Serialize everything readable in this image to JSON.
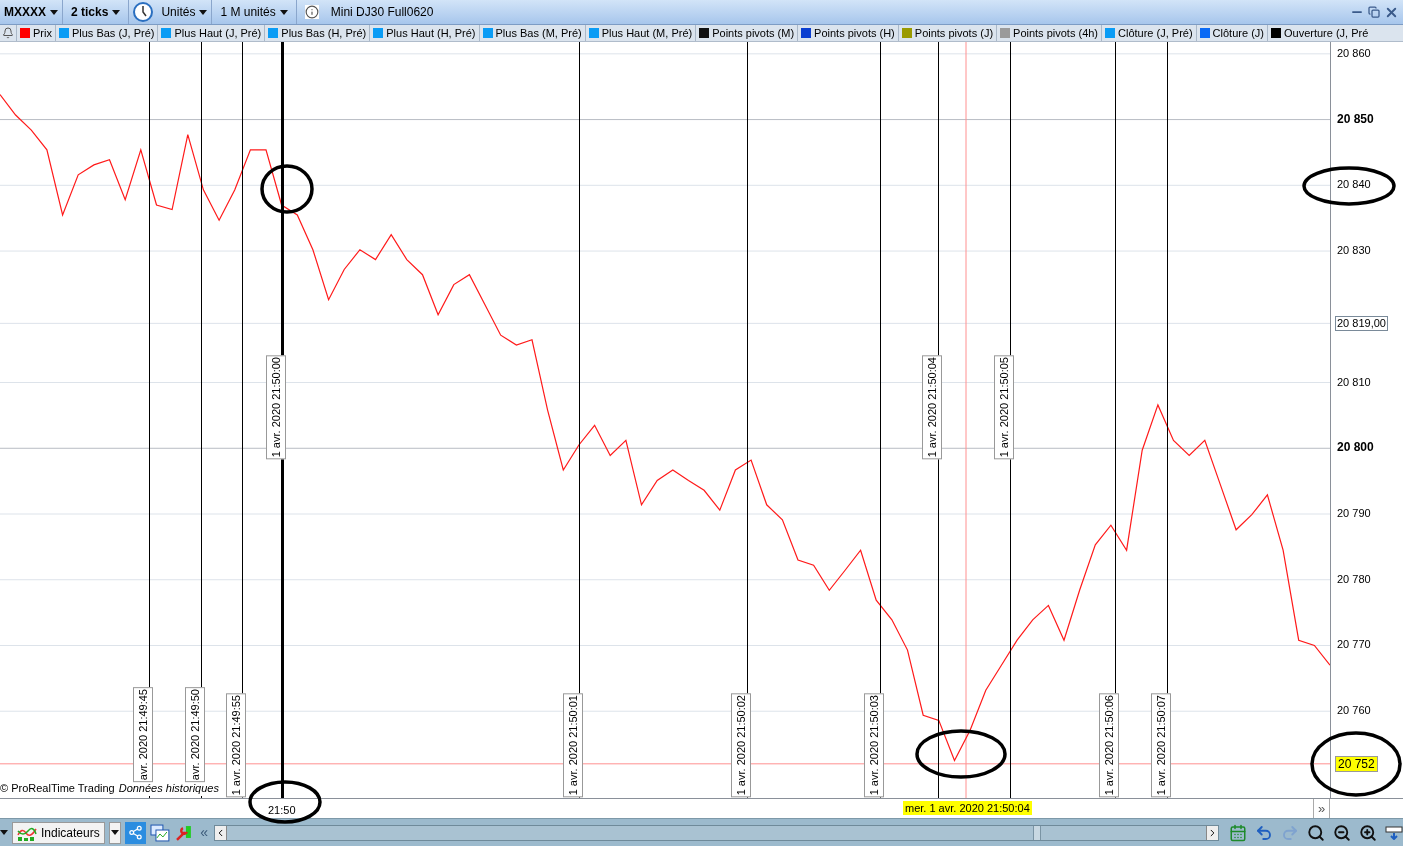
{
  "toolbar": {
    "instrument": "MXXXX",
    "interval": "2 ticks",
    "unit_type": "Unités",
    "units": "1 M unités",
    "title": "Mini DJ30 Full0620"
  },
  "legend": [
    {
      "label": "Prix",
      "color": "#ff0000"
    },
    {
      "label": "Plus Bas (J, Pré)",
      "color": "#0a9cf5"
    },
    {
      "label": "Plus Haut (J, Pré)",
      "color": "#0a9cf5"
    },
    {
      "label": "Plus Bas (H, Pré)",
      "color": "#0a9cf5"
    },
    {
      "label": "Plus Haut (H, Pré)",
      "color": "#0a9cf5"
    },
    {
      "label": "Plus Bas (M, Pré)",
      "color": "#0a9cf5"
    },
    {
      "label": "Plus Haut (M, Pré)",
      "color": "#0a9cf5"
    },
    {
      "label": "Points pivots (M)",
      "color": "#111111"
    },
    {
      "label": "Points pivots (H)",
      "color": "#0b3fd1"
    },
    {
      "label": "Points pivots (J)",
      "color": "#9a9a00"
    },
    {
      "label": "Points pivots (4h)",
      "color": "#9a9a9a"
    },
    {
      "label": "Clôture (J, Pré)",
      "color": "#0a9cf5"
    },
    {
      "label": "Clôture (J)",
      "color": "#0a6af5"
    },
    {
      "label": "Ouverture (J, Pré",
      "color": "#000000"
    }
  ],
  "chart": {
    "chart_data": {
      "type": "line",
      "ylim": [
        20746.8,
        20861.8
      ],
      "grid": true,
      "ref_lines": [
        {
          "axis": "y",
          "value": 20752,
          "color": "#ff9090"
        }
      ],
      "yticks": [
        {
          "value": 20760,
          "label": "20 760"
        },
        {
          "value": 20770,
          "label": "20 770"
        },
        {
          "value": 20780,
          "label": "20 780"
        },
        {
          "value": 20790,
          "label": "20 790"
        },
        {
          "value": 20800,
          "label": "20 800"
        },
        {
          "value": 20810,
          "label": "20 810"
        },
        {
          "value": 20830,
          "label": "20 830"
        },
        {
          "value": 20840,
          "label": "20 840"
        },
        {
          "value": 20850,
          "label": "20 850"
        },
        {
          "value": 20860,
          "label": "20 860"
        }
      ],
      "series": [
        {
          "color": "#ff1a1a",
          "values": [
            20853.8,
            20850.7,
            20848.4,
            20845.4,
            20835.5,
            20841.6,
            20843.1,
            20843.9,
            20837.8,
            20845.4,
            20837,
            20836.3,
            20847.7,
            20839.3,
            20834.7,
            20839.3,
            20845.4,
            20845.4,
            20837,
            20835.5,
            20830.2,
            20822.6,
            20827.2,
            20830.2,
            20828.7,
            20832.5,
            20828.7,
            20826.4,
            20820.3,
            20824.9,
            20826.4,
            20821.8,
            20817.2,
            20815.7,
            20816.5,
            20805.8,
            20796.7,
            20800.5,
            20803.5,
            20798.9,
            20801.2,
            20791.4,
            20795.1,
            20796.7,
            20795.1,
            20793.6,
            20790.6,
            20796.7,
            20798.2,
            20791.4,
            20789.1,
            20783,
            20782.2,
            20778.4,
            20781.4,
            20784.5,
            20776.9,
            20773.9,
            20769.3,
            20759.4,
            20758.6,
            20752.5,
            20757.1,
            20763.2,
            20767,
            20770.8,
            20773.9,
            20776.1,
            20770.8,
            20778.4,
            20785.3,
            20788.3,
            20784.5,
            20799.7,
            20806.6,
            20801.2,
            20798.9,
            20801.2,
            20794.4,
            20787.6,
            20789.9,
            20792.9,
            20784.5,
            20770.8,
            20770,
            20767
          ]
        }
      ]
    },
    "price_marker": "20 819,00",
    "last_price": "20 752",
    "markers": [
      {
        "label": "avr. 2020 21:49:45",
        "kind": "bottom",
        "thick": false
      },
      {
        "label": "avr. 2020 21:49:50",
        "kind": "bottom",
        "thick": false
      },
      {
        "label": "1 avr. 2020 21:49:55",
        "kind": "bottom",
        "thick": false
      },
      {
        "label": "1 avr. 2020 21:50:00",
        "kind": "middle",
        "thick": true
      },
      {
        "label": "1 avr. 2020 21:50:01",
        "kind": "bottom",
        "thick": false
      },
      {
        "label": "1 avr. 2020 21:50:02",
        "kind": "bottom",
        "thick": false
      },
      {
        "label": "1 avr. 2020 21:50:03",
        "kind": "bottom",
        "thick": false
      },
      {
        "label": "1 avr. 2020 21:50:04",
        "kind": "middle",
        "thick": false
      },
      {
        "label": "1 avr. 2020 21:50:05",
        "kind": "middle",
        "thick": false
      },
      {
        "label": "1 avr. 2020 21:50:06",
        "kind": "bottom",
        "thick": false
      },
      {
        "label": "1 avr. 2020 21:50:07",
        "kind": "bottom",
        "thick": false
      }
    ],
    "copyright": "© ProRealTime Trading",
    "source": "Données historiques",
    "x_axis_label": "21:50",
    "cursor_time": "mer. 1 avr. 2020 21:50:04"
  },
  "bottom_toolbar": {
    "indicators": "Indicateurs",
    "scroll_left": "«",
    "expand": "»"
  }
}
